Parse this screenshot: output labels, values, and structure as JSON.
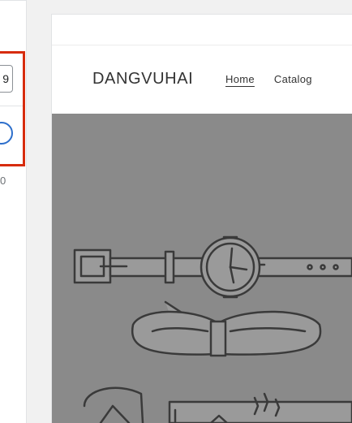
{
  "settings_panel": {
    "input_value": "9",
    "bottom_value": "0"
  },
  "preview": {
    "store_name": "DANGVUHAI",
    "nav": [
      {
        "label": "Home",
        "active": true
      },
      {
        "label": "Catalog",
        "active": false
      }
    ],
    "hero_image": "line-art illustration of watch, bow tie and accessories",
    "colors": {
      "hero_bg": "#8a8a8a",
      "highlight": "#d72c0d",
      "accent": "#2c6ecb"
    }
  }
}
